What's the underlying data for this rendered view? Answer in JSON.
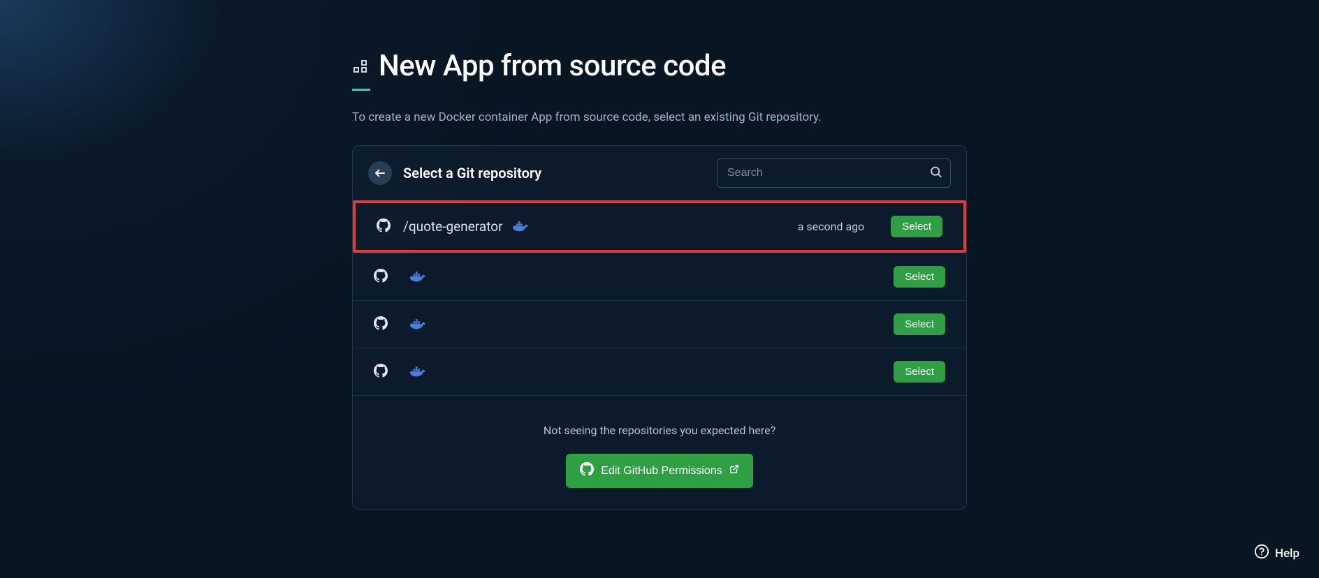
{
  "page": {
    "title": "New App from source code",
    "subtitle": "To create a new Docker container App from source code, select an existing Git repository."
  },
  "panel": {
    "title": "Select a Git repository",
    "search_placeholder": "Search"
  },
  "repos": [
    {
      "name": "/quote-generator",
      "time": "a second ago",
      "select_label": "Select",
      "highlighted": true
    },
    {
      "name": "",
      "time": "",
      "select_label": "Select",
      "highlighted": false
    },
    {
      "name": "",
      "time": "",
      "select_label": "Select",
      "highlighted": false
    },
    {
      "name": "",
      "time": "",
      "select_label": "Select",
      "highlighted": false
    }
  ],
  "footer": {
    "question": "Not seeing the repositories you expected here?",
    "button_label": "Edit GitHub Permissions"
  },
  "help": {
    "label": "Help"
  }
}
